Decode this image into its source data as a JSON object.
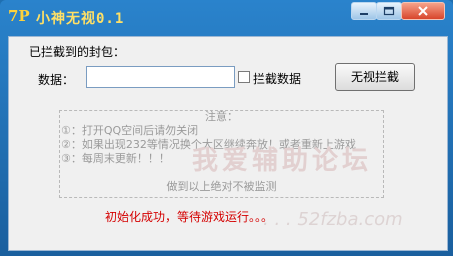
{
  "window": {
    "title": "小神无视0.1",
    "app_icon_text": "7P"
  },
  "form": {
    "blocked_packets_label": "已拦截到的封包：",
    "data_label": "数据：",
    "data_value": "",
    "intercept_checkbox_label": "拦截数据",
    "intercept_checked": false,
    "ignore_button_label": "无视拦截"
  },
  "notice": {
    "title": "注意：",
    "lines": [
      "①：打开QQ空间后请勿关闭",
      "②：如果出现232等情况换个大区继续奔放！或者重新上游戏",
      "③：每周末更新！！！"
    ],
    "footer": "做到以上绝对不被监测"
  },
  "status": {
    "text": "初始化成功，等待游戏运行。。。",
    "color": "#d40000"
  },
  "watermark": {
    "cn": "我爱辅助论坛",
    "url": ". . . 52fzba.com"
  }
}
